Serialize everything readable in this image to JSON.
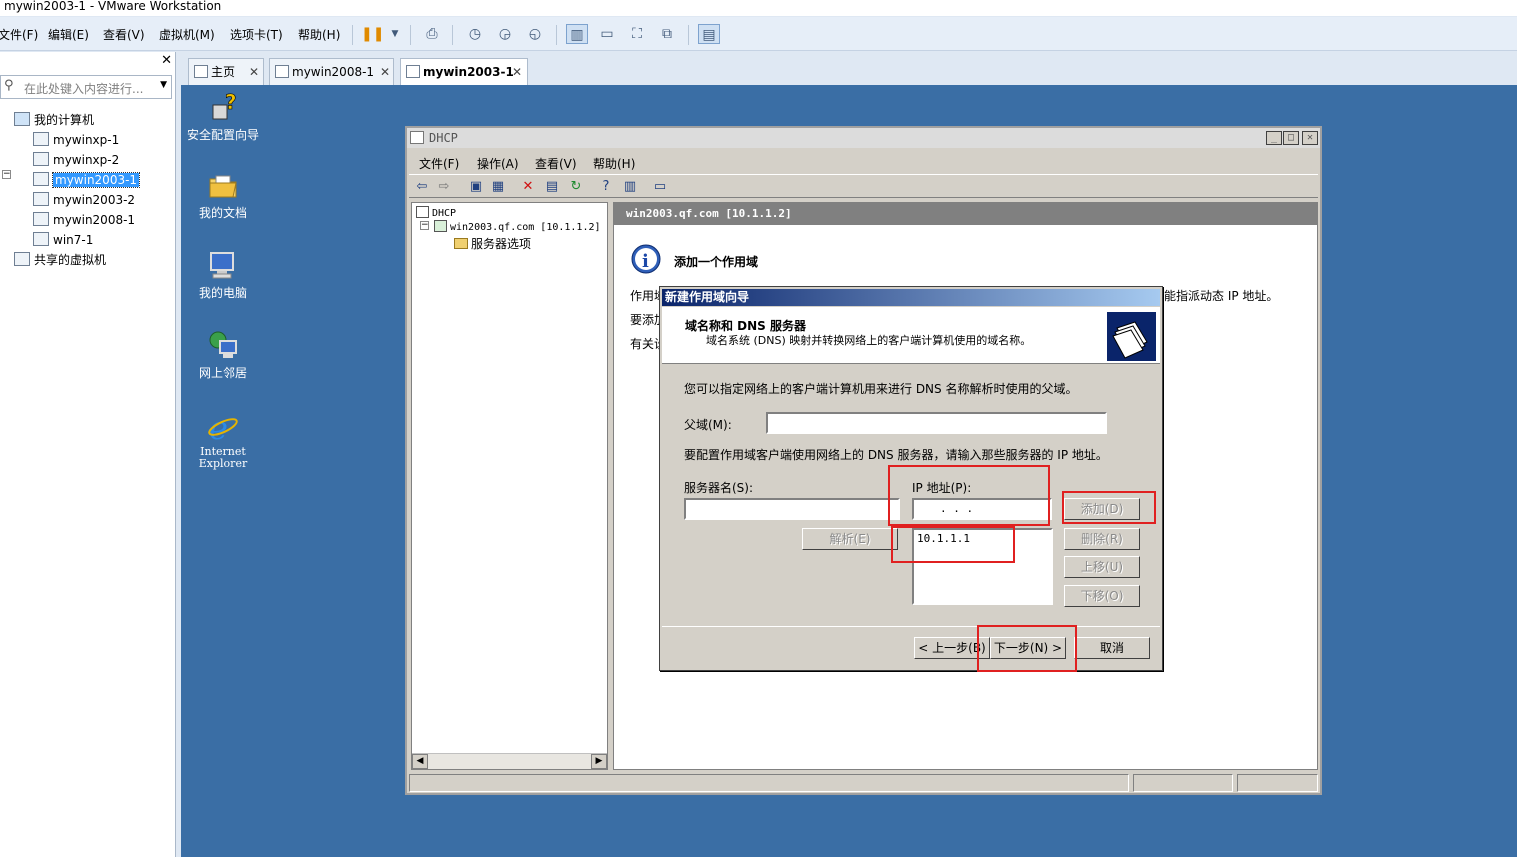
{
  "window_title": "mywin2003-1 - VMware Workstation",
  "menu": [
    "文件(F)",
    "编辑(E)",
    "查看(V)",
    "虚拟机(M)",
    "选项卡(T)",
    "帮助(H)"
  ],
  "library": {
    "search_placeholder": "在此处键入内容进行...",
    "root": "我的计算机",
    "vms": [
      "mywinxp-1",
      "mywinxp-2",
      "mywin2003-1",
      "mywin2003-2",
      "mywin2008-1",
      "win7-1"
    ],
    "selected": "mywin2003-1",
    "shared": "共享的虚拟机"
  },
  "tabs": [
    {
      "label": "主页"
    },
    {
      "label": "mywin2008-1"
    },
    {
      "label": "mywin2003-1"
    }
  ],
  "desktop_icons": [
    {
      "label": "安全配置向导",
      "icon": "security-wizard-icon"
    },
    {
      "label": "我的文档",
      "icon": "folder-icon"
    },
    {
      "label": "我的电脑",
      "icon": "computer-icon"
    },
    {
      "label": "网上邻居",
      "icon": "network-icon"
    },
    {
      "label_line1": "Internet",
      "label_line2": "Explorer",
      "icon": "ie-icon"
    }
  ],
  "dhcp": {
    "title": "DHCP",
    "menu": [
      "文件(F)",
      "操作(A)",
      "查看(V)",
      "帮助(H)"
    ],
    "tree": {
      "root": "DHCP",
      "server": "win2003.qf.com [10.1.1.2]",
      "child": "服务器选项"
    },
    "right_header": "win2003.qf.com [10.1.1.2]",
    "heading": "添加一个作用域",
    "body_lines": [
      "作用域",
      "要添加",
      "有关设"
    ],
    "body_tail": "能指派动态 IP 地址。"
  },
  "wizard": {
    "title": "新建作用域向导",
    "header_title": "域名称和 DNS 服务器",
    "header_subtitle": "域名系统 (DNS) 映射并转换网络上的客户端计算机使用的域名称。",
    "intro": "您可以指定网络上的客户端计算机用来进行 DNS 名称解析时使用的父域。",
    "parent_domain_label": "父域(M):",
    "parent_domain_value": "",
    "dns_instruction": "要配置作用域客户端使用网络上的 DNS 服务器，请输入那些服务器的 IP 地址。",
    "server_name_label": "服务器名(S):",
    "server_name_value": "",
    "ip_label": "IP 地址(P):",
    "ip_value": ".   .   .",
    "resolve_button": "解析(E)",
    "ip_list": [
      "10.1.1.1"
    ],
    "add_button": "添加(D)",
    "remove_button": "删除(R)",
    "up_button": "上移(U)",
    "down_button": "下移(O)",
    "back_button": "< 上一步(B)",
    "next_button": "下一步(N) >",
    "cancel_button": "取消"
  },
  "colors": {
    "desktop": "#3a6ea5",
    "highlight": "#e02020",
    "wizard_title": "#0a246a"
  }
}
